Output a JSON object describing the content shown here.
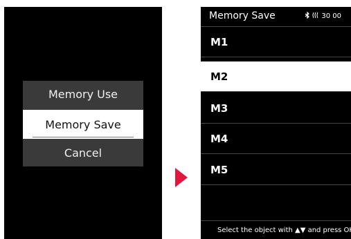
{
  "left_menu": {
    "items": [
      {
        "label": "Memory Use"
      },
      {
        "label": "Memory Save",
        "selected": true
      },
      {
        "label": "Cancel"
      }
    ]
  },
  "right_screen": {
    "title": "Memory Save",
    "status": {
      "bluetooth_icon": "bluetooth-icon",
      "signal_icon": "signal-icon",
      "value": "30 00"
    },
    "slots": [
      {
        "label": "M1",
        "selected": false
      },
      {
        "label": "M2",
        "selected": true
      },
      {
        "label": "M3",
        "selected": false
      },
      {
        "label": "M4",
        "selected": false
      },
      {
        "label": "M5",
        "selected": false
      }
    ],
    "footer_text": "Select the object with ▲▼ and press OK"
  },
  "colors": {
    "arrow": "#e3173e",
    "screen_bg": "#000000",
    "menu_bg": "#3a3a3a",
    "selected_bg": "#ffffff"
  }
}
